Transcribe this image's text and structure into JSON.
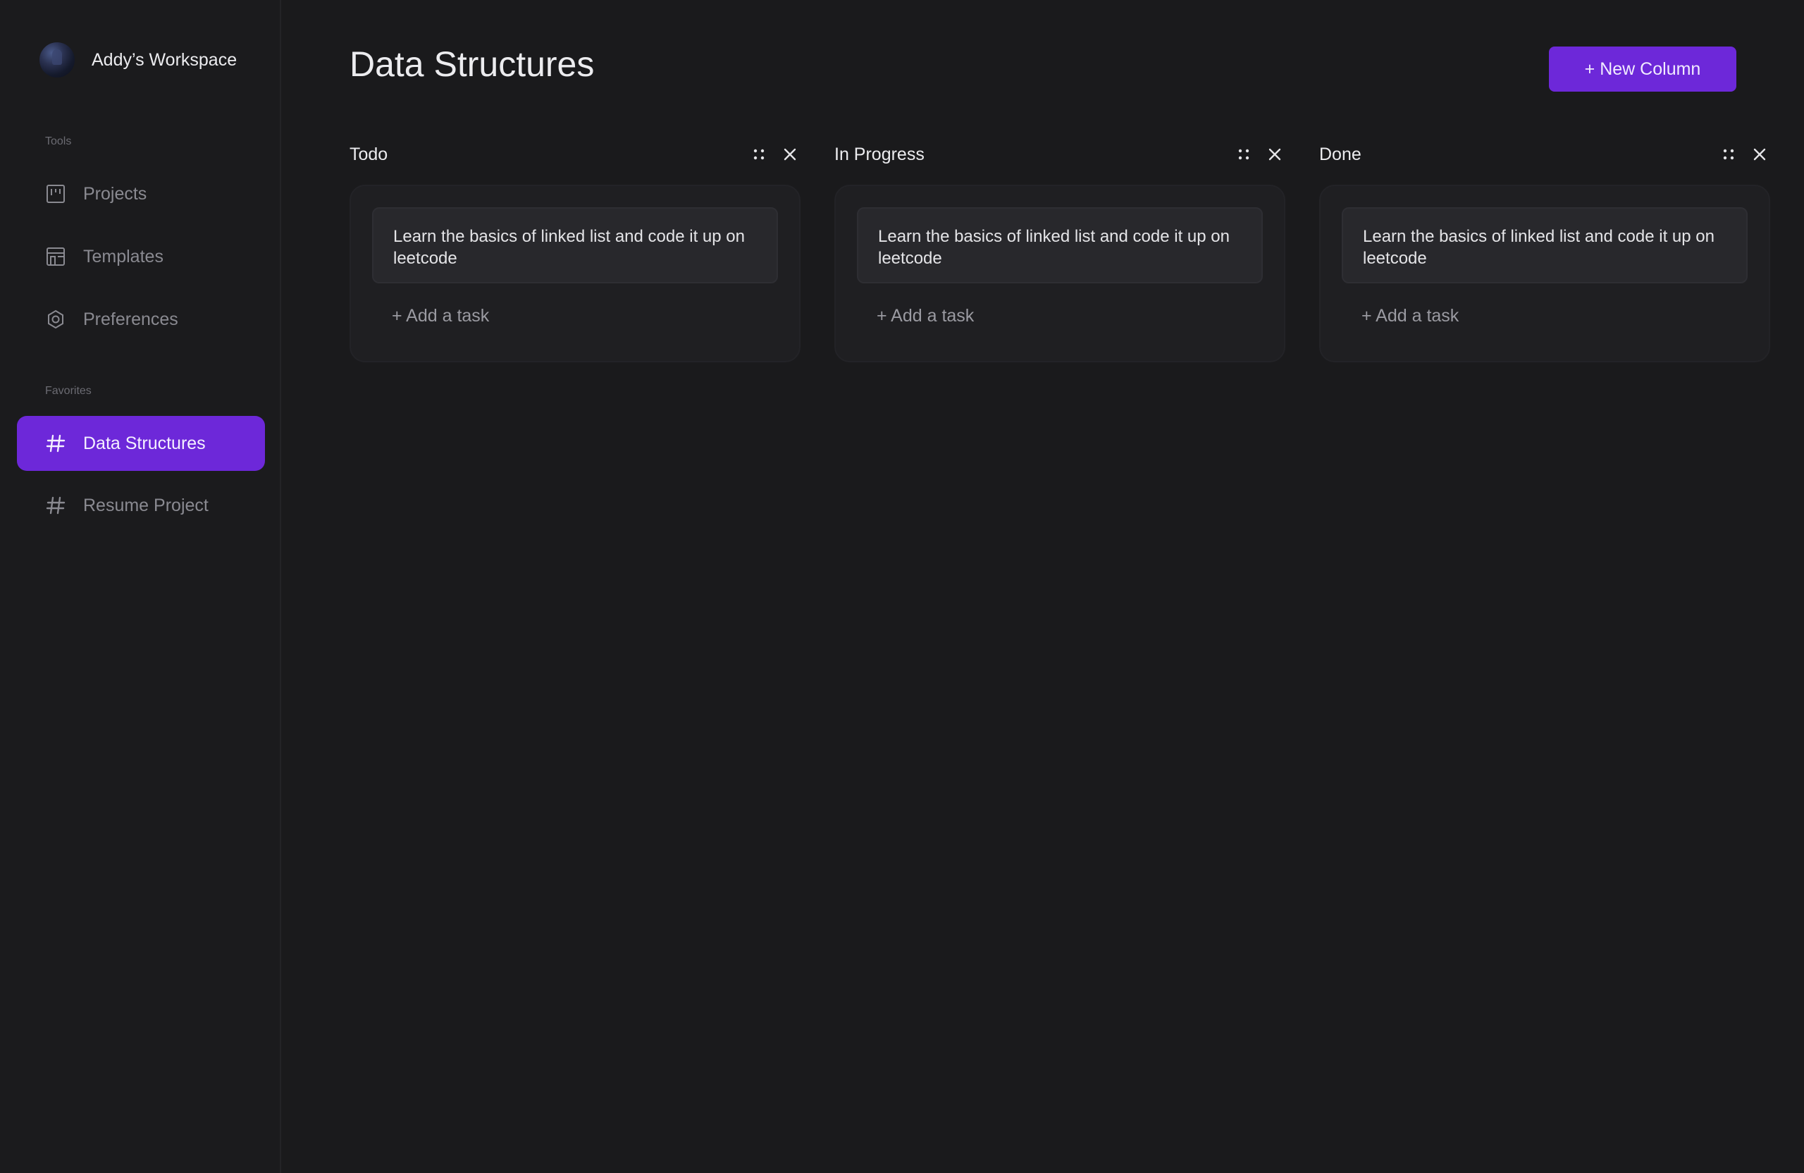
{
  "workspace": {
    "name": "Addy’s Workspace"
  },
  "sidebar": {
    "tools_label": "Tools",
    "tools": [
      {
        "label": "Projects",
        "icon": "kanban-icon"
      },
      {
        "label": "Templates",
        "icon": "layout-icon"
      },
      {
        "label": "Preferences",
        "icon": "gear-icon"
      }
    ],
    "favorites_label": "Favorites",
    "favorites": [
      {
        "label": "Data Structures",
        "icon": "hash-icon",
        "active": true
      },
      {
        "label": "Resume Project",
        "icon": "hash-icon",
        "active": false
      }
    ]
  },
  "header": {
    "title": "Data Structures",
    "new_column_label": "+ New Column"
  },
  "columns": [
    {
      "title": "Todo",
      "tasks": [
        "Learn the basics of linked list and code it up on leetcode"
      ],
      "add_label": "+ Add a task"
    },
    {
      "title": "In Progress",
      "tasks": [
        "Learn the basics of linked list and code it up on leetcode"
      ],
      "add_label": "+ Add a task"
    },
    {
      "title": "Done",
      "tasks": [
        "Learn the basics of linked list and code it up on leetcode"
      ],
      "add_label": "+ Add a task"
    }
  ],
  "colors": {
    "accent": "#6d28d9",
    "background": "#1a1a1c",
    "card": "#28282c"
  }
}
